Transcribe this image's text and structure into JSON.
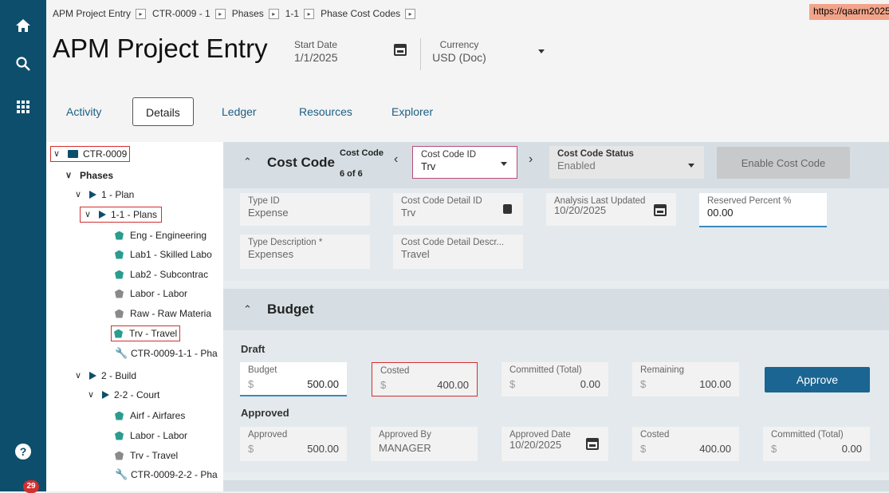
{
  "leftbar": {
    "notif_count": "29"
  },
  "breadcrumb": [
    "APM Project Entry",
    "CTR-0009 - 1",
    "Phases",
    "1-1",
    "Phase Cost Codes"
  ],
  "url": "https://qaarm2025",
  "header": {
    "title": "APM Project Entry",
    "start_date_label": "Start Date",
    "start_date": "1/1/2025",
    "currency_label": "Currency",
    "currency": "USD (Doc)"
  },
  "tabs": [
    "Activity",
    "Details",
    "Ledger",
    "Resources",
    "Explorer"
  ],
  "tree": {
    "root": "CTR-0009",
    "phases": "Phases",
    "plan": "1 - Plan",
    "plans": "1-1 - Plans",
    "items1": [
      "Eng - Engineering",
      "Lab1 - Skilled Labo",
      "Lab2 - Subcontrac",
      "Labor - Labor",
      "Raw - Raw Materia",
      "Trv - Travel"
    ],
    "phase1": "CTR-0009-1-1 - Pha",
    "build": "2 - Build",
    "court": "2-2 - Court",
    "items2": [
      "Airf - Airfares",
      "Labor - Labor",
      "Trv - Travel"
    ],
    "phase2": "CTR-0009-2-2 - Pha"
  },
  "costcode": {
    "title": "Cost Code",
    "nav_label": "Cost Code",
    "nav_count": "6 of 6",
    "id_label": "Cost Code ID",
    "id_value": "Trv",
    "status_label": "Cost Code Status",
    "status_value": "Enabled",
    "enable_button": "Enable Cost Code",
    "type_id_label": "Type ID",
    "type_id": "Expense",
    "detail_id_label": "Cost Code Detail ID",
    "detail_id": "Trv",
    "analysis_label": "Analysis Last Updated",
    "analysis_value": "10/20/2025",
    "reserved_label": "Reserved Percent %",
    "reserved_value": "00.00",
    "type_desc_label": "Type Description *",
    "type_desc": "Expenses",
    "detail_desc_label": "Cost Code Detail Descr...",
    "detail_desc": "Travel"
  },
  "budget": {
    "title": "Budget",
    "draft": "Draft",
    "approved": "Approved",
    "currency": "$",
    "budget_label": "Budget",
    "budget_value": "500.00",
    "costed_label": "Costed",
    "costed_value": "400.00",
    "committed_label": "Committed (Total)",
    "committed_value": "0.00",
    "remaining_label": "Remaining",
    "remaining_value": "100.00",
    "approve_button": "Approve",
    "appr_label": "Approved",
    "appr_value": "500.00",
    "appr_by_label": "Approved By",
    "appr_by": "MANAGER",
    "appr_date_label": "Approved Date",
    "appr_date": "10/20/2025",
    "appr_costed_label": "Costed",
    "appr_costed": "400.00",
    "appr_committed_label": "Committed (Total)",
    "appr_committed": "0.00"
  }
}
